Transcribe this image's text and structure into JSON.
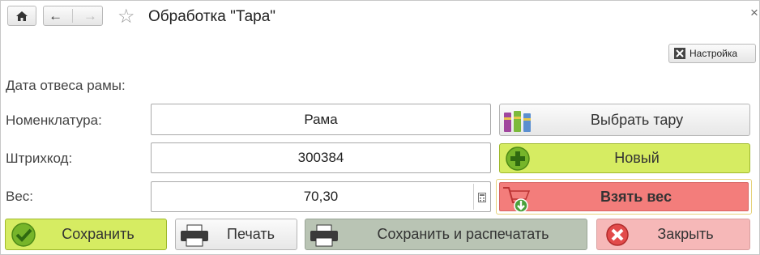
{
  "window": {
    "title": "Обработка \"Тара\"",
    "close_glyph": "×"
  },
  "toolbar": {
    "settings_label": "Настройка"
  },
  "form": {
    "date_label": "Дата отвеса рамы:",
    "nomenclature_label": "Номенклатура:",
    "nomenclature_value": "Рама",
    "barcode_label": "Штрихкод:",
    "barcode_value": "300384",
    "weight_label": "Вес:",
    "weight_value": "70,30"
  },
  "side_buttons": {
    "choose_tare": "Выбрать тару",
    "new": "Новый",
    "take_weight": "Взять вес"
  },
  "bottom_buttons": {
    "save": "Сохранить",
    "print": "Печать",
    "save_print": "Сохранить и распечатать",
    "close": "Закрыть"
  },
  "colors": {
    "green": "#d6ec62",
    "red": "#f37d7b",
    "gray_green": "#b9c4b4",
    "pink": "#f6b8b8"
  }
}
